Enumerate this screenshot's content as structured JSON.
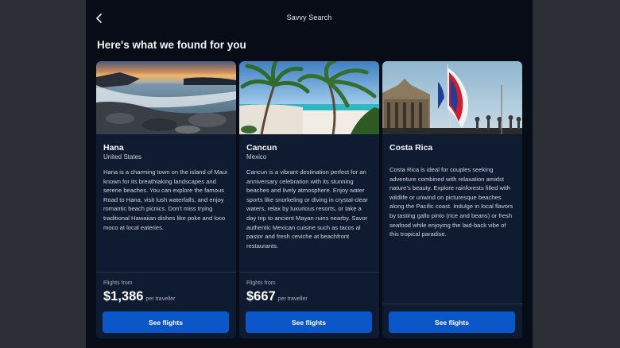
{
  "header": {
    "title": "Savvy Search",
    "back_icon": "chevron-left-icon"
  },
  "heading": "Here's what we found for you",
  "colors": {
    "app_background": "#070c17",
    "card_background": "#0f1b30",
    "button": "#0b57c9"
  },
  "cards": [
    {
      "name": "Hana",
      "country": "United States",
      "description": "Hana is a charming town on the island of Maui known for its breathtaking landscapes and serene beaches. You can explore the famous Road to Hana, visit lush waterfalls, and enjoy romantic beach picnics. Don't miss trying traditional Hawaiian dishes like poke and loco moco at local eateries.",
      "flights_from_label": "Flights from",
      "price": "$1,386",
      "per_label": "per traveller",
      "button_label": "See flights",
      "image": "rocky-beach-sunset-photo"
    },
    {
      "name": "Cancun",
      "country": "Mexico",
      "description": "Cancun is a vibrant destination perfect for an anniversary celebration with its stunning beaches and lively atmosphere. Enjoy water sports like snorkeling or diving in crystal-clear waters, relax by luxurious resorts, or take a day trip to ancient Mayan ruins nearby. Savor authentic Mexican cuisine such as tacos al pastor and fresh ceviche at beachfront restaurants.",
      "flights_from_label": "Flights from",
      "price": "$667",
      "per_label": "per traveller",
      "button_label": "See flights",
      "image": "palm-tree-beach-photo"
    },
    {
      "name": "Costa Rica",
      "country": "",
      "description": "Costa Rica is ideal for couples seeking adventure combined with relaxation amidst nature's beauty. Explore rainforests filled with wildlife or unwind on picturesque beaches along the Pacific coast. Indulge in local flavors by tasting gallo pinto (rice and beans) or fresh seafood while enjoying the laid-back vibe of this tropical paradise.",
      "button_label": "See flights",
      "image": "costa-rica-flag-photo"
    }
  ]
}
